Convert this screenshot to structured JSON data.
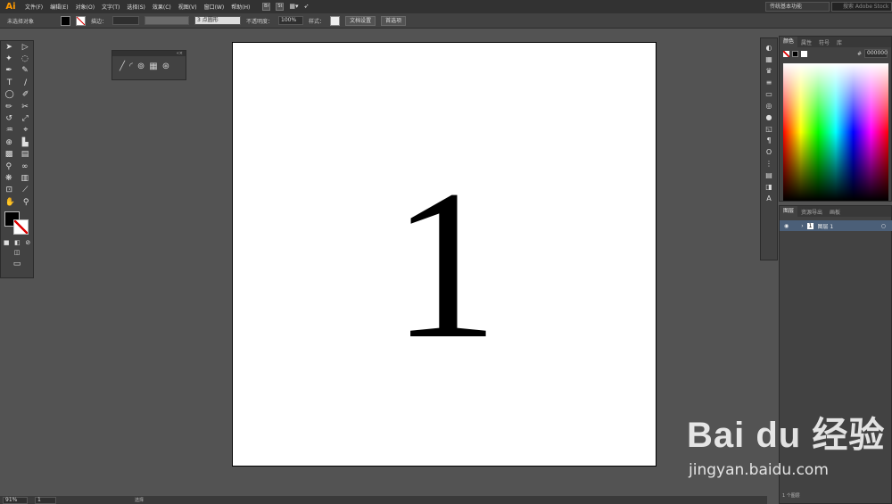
{
  "app": {
    "logo": "Ai"
  },
  "menu": [
    "文件(F)",
    "编辑(E)",
    "对象(O)",
    "文字(T)",
    "选择(S)",
    "效果(C)",
    "视图(V)",
    "窗口(W)",
    "帮助(H)"
  ],
  "bridge": [
    "Br",
    "St"
  ],
  "workspace": "传统基本功能",
  "stock_search": "搜索 Adobe Stock",
  "control": {
    "selection_label": "未选择对象",
    "stroke_label": "描边：",
    "brush_value": "3 点圆形",
    "opacity_label": "不透明度：",
    "opacity_value": "100%",
    "style_label": "样式：",
    "doc_setup": "文档设置",
    "prefs": "首选项"
  },
  "artboard": {
    "text": "1"
  },
  "color_panel": {
    "tabs": [
      "颜色",
      "属性",
      "符号",
      "库"
    ],
    "hex_prefix": "#",
    "hex": "000000"
  },
  "layers_panel": {
    "tabs": [
      "图层",
      "资源导出",
      "画板"
    ],
    "layer_num": "1",
    "layer_name": "图层 1",
    "count": "1 个图层"
  },
  "status": {
    "zoom": "91%",
    "page": "1",
    "mode": "选择"
  },
  "watermark": {
    "logo": "Bai du 经验",
    "url": "jingyan.baidu.com"
  }
}
